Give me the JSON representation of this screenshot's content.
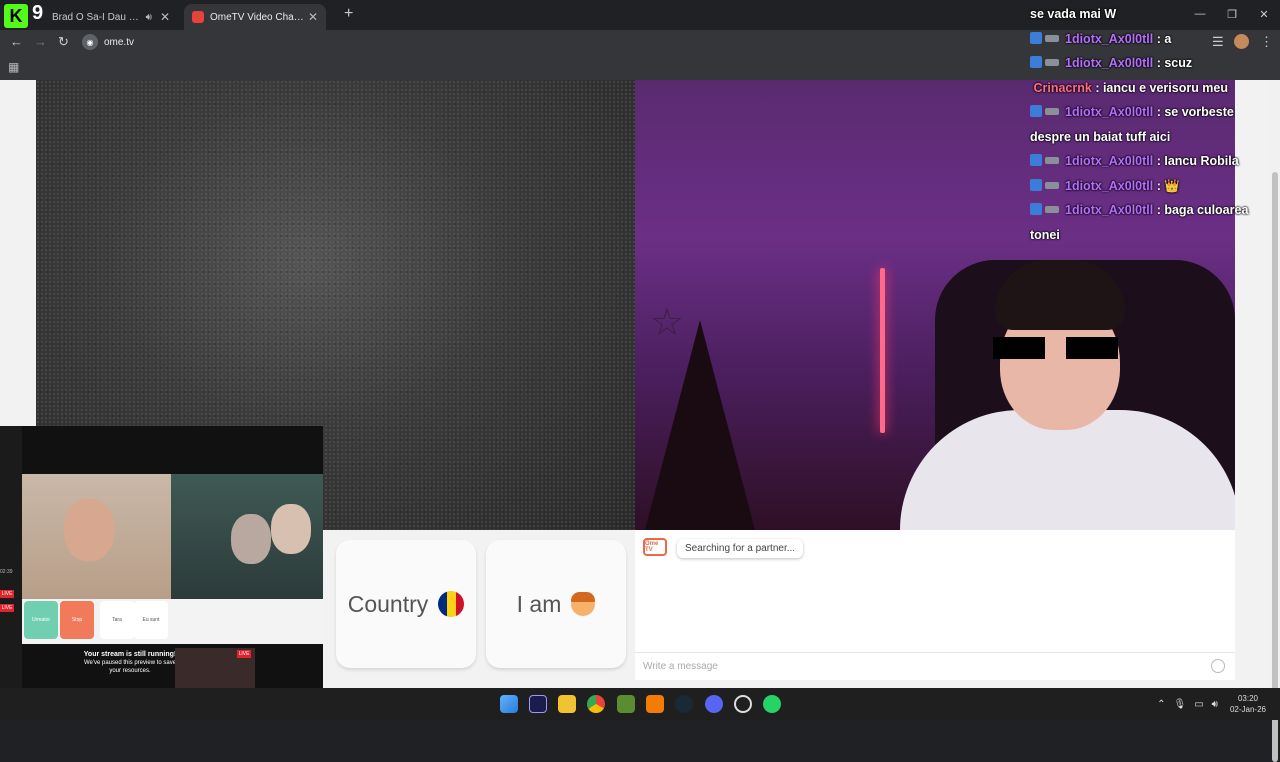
{
  "browser": {
    "tabs": [
      {
        "title": "Brad O Sa-I Dau Foc • To",
        "active": false
      },
      {
        "title": "OmeTV Video Chat — Ome",
        "active": true
      }
    ],
    "url": "ome.tv"
  },
  "stream_overlay": {
    "messages": [
      {
        "user": "",
        "text": "se vada mai W"
      },
      {
        "user": "1diotx_Ax0l0tll",
        "text": "a"
      },
      {
        "user": "1diotx_Ax0l0tll",
        "text": "scuz"
      },
      {
        "user": "Crinacrnk",
        "text": "iancu e verisoru meu"
      },
      {
        "user": "1diotx_Ax0l0tll",
        "text": "se vorbeste despre un baiat tuff aici"
      },
      {
        "user": "1diotx_Ax0l0tll",
        "text": "Iancu Robila"
      },
      {
        "user": "1diotx_Ax0l0tll",
        "text": "👑"
      },
      {
        "user": "1diotx_Ax0l0tll",
        "text": "baga culoarea tonei"
      }
    ],
    "logo_text": "9"
  },
  "ome": {
    "country_label": "Country",
    "iam_label": "I am",
    "searching": "Searching for a partner...",
    "message_placeholder": "Write a message",
    "logo": "Ome TV"
  },
  "pip": {
    "notice_title": "Your stream is still running!",
    "notice_body": "We've paused this preview to save your resources.",
    "live": "LIVE",
    "time": "02:39",
    "buttons": [
      "Urmator",
      "Stop",
      "Tara",
      "Eu sunt"
    ]
  },
  "taskbar": {
    "time": "03:20",
    "date": "02-Jan-26"
  },
  "colors": {
    "ome_accent": "#e86a4a",
    "username": "#b56cff",
    "username_alt": "#ff6e7f"
  }
}
